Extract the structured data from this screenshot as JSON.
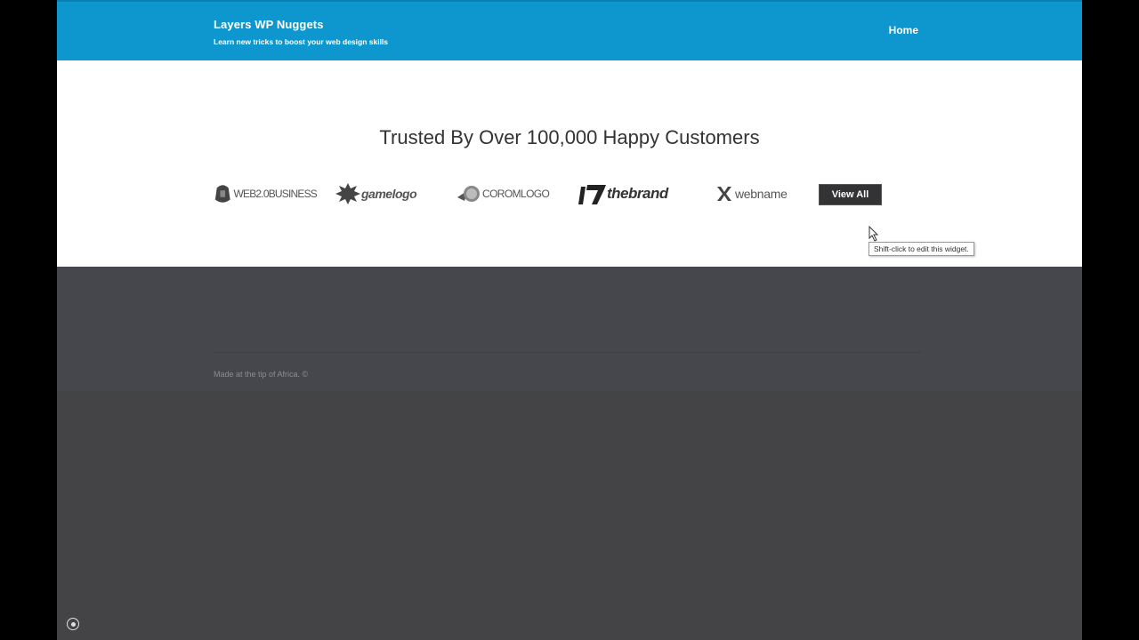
{
  "header": {
    "site_title": "Layers WP Nuggets",
    "tagline": "Learn new tricks to boost your web design skills",
    "nav": [
      {
        "label": "Home"
      }
    ]
  },
  "widget": {
    "heading": "Trusted By Over 100,000 Happy Customers",
    "logos": [
      {
        "name": "web20business-logo",
        "text": "WEB2.0BUSINESS"
      },
      {
        "name": "gamelogo-logo",
        "text": "gamelogo"
      },
      {
        "name": "coromlogo-logo",
        "text": "COROMLOGO"
      },
      {
        "name": "thebrand-logo",
        "text": "thebrand"
      },
      {
        "name": "webname-logo",
        "text": "webname"
      }
    ],
    "view_all_label": "View All",
    "tooltip": "Shift-click to edit this widget."
  },
  "footer": {
    "copyright": "Made at the tip of Africa. ©"
  },
  "colors": {
    "header_bg": "#0e97cf",
    "widget_bg": "#ffffff",
    "footer_bg": "#45474c",
    "page_bg": "#444446",
    "button_bg": "#333335"
  },
  "icons": {
    "customize": "customize-icon",
    "cursor": "mouse-pointer-icon"
  }
}
